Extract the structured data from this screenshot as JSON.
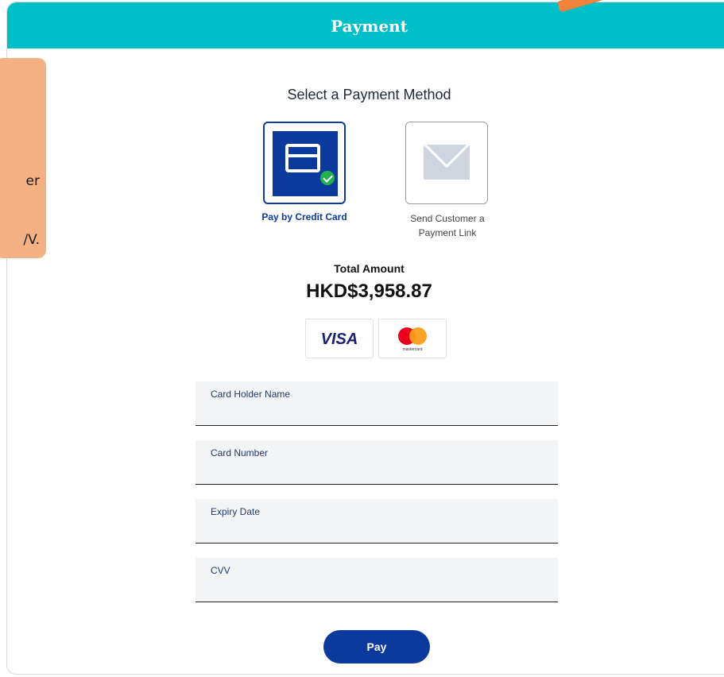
{
  "header": {
    "title": "Payment"
  },
  "tooltip": {
    "line1": "er",
    "line2": "/V."
  },
  "payment_method": {
    "title": "Select a Payment Method",
    "options": [
      {
        "label": "Pay by Credit Card",
        "icon": "credit-card-icon",
        "selected": true
      },
      {
        "label_line1": "Send Customer a",
        "label_line2": "Payment Link",
        "icon": "envelope-icon",
        "selected": false
      }
    ]
  },
  "total": {
    "label": "Total Amount",
    "amount": "HKD$3,958.87"
  },
  "brands": {
    "visa": "VISA",
    "mastercard": "mastercard"
  },
  "form": {
    "card_holder_label": "Card Holder Name",
    "card_number_label": "Card Number",
    "expiry_label": "Expiry Date",
    "cvv_label": "CVV",
    "card_holder_value": "",
    "card_number_value": "",
    "expiry_value": "",
    "cvv_value": ""
  },
  "pay_button": {
    "label": "Pay"
  },
  "colors": {
    "header": "#00bfc6",
    "primary": "#0b3a9c",
    "tooltip": "#f4b183",
    "pointer": "#f0823c",
    "check": "#22b14c"
  }
}
